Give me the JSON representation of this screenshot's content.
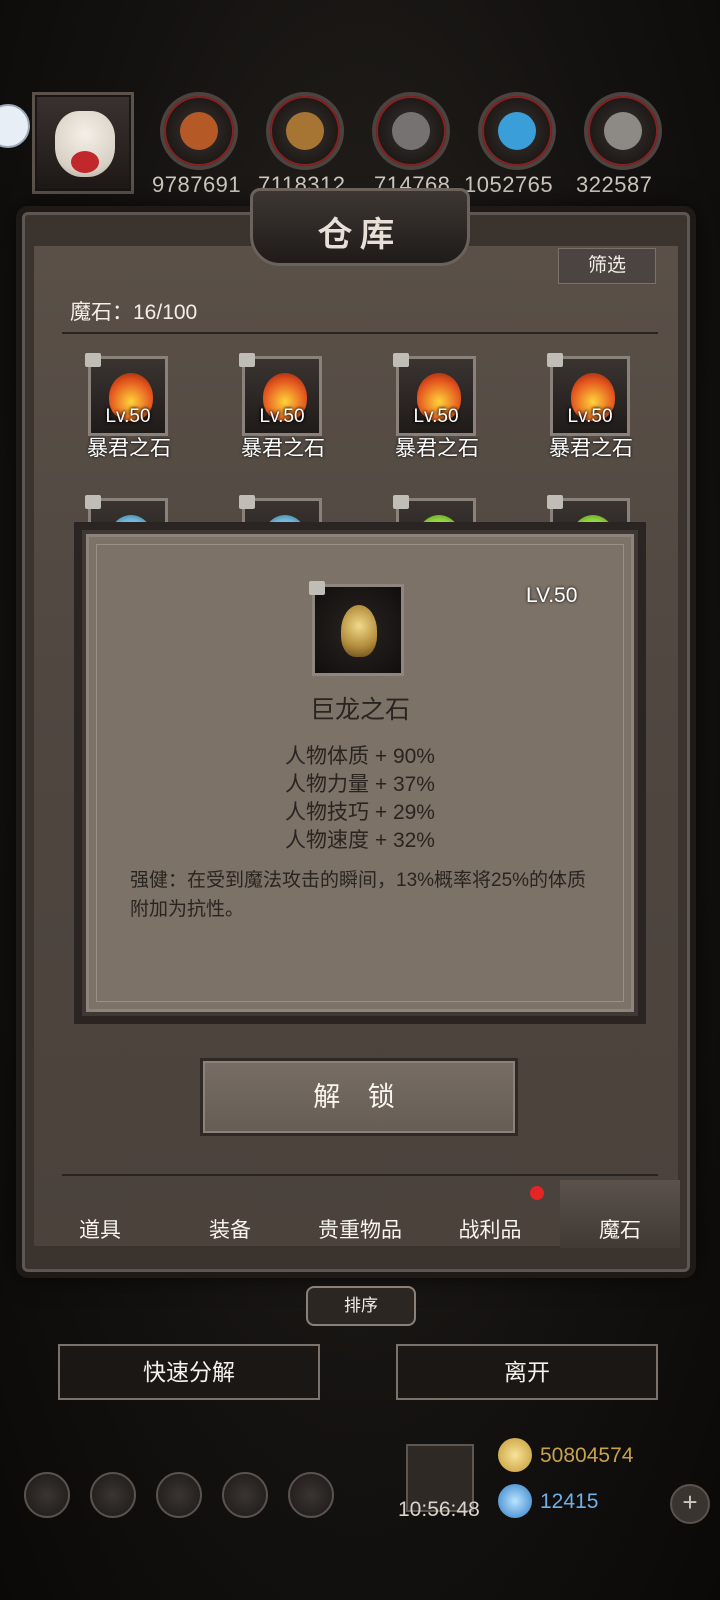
{
  "resources": [
    {
      "icon": "meat-icon",
      "value": "9787691",
      "color": "#b55a26"
    },
    {
      "icon": "wood-icon",
      "value": "7118312",
      "color": "#a77533"
    },
    {
      "icon": "iron-icon",
      "value": "714768",
      "color": "#777272"
    },
    {
      "icon": "crystal-icon",
      "value": "1052765",
      "color": "#3a9ed8"
    },
    {
      "icon": "silver-icon",
      "value": "322587",
      "color": "#8d8a86"
    }
  ],
  "warehouse": {
    "title": "仓库",
    "filter_label": "筛选",
    "count_label": "魔石：16/100",
    "items": [
      {
        "lv": "Lv.50",
        "name": "暴君之石",
        "color": "#e3541e"
      },
      {
        "lv": "Lv.50",
        "name": "暴君之石",
        "color": "#e3541e"
      },
      {
        "lv": "Lv.50",
        "name": "暴君之石",
        "color": "#e3541e"
      },
      {
        "lv": "Lv.50",
        "name": "暴君之石",
        "color": "#e3541e"
      },
      {
        "lv": "",
        "name": "",
        "color": "#6fb6d8"
      },
      {
        "lv": "",
        "name": "",
        "color": "#6fb6d8"
      },
      {
        "lv": "",
        "name": "",
        "color": "#8fd23f"
      },
      {
        "lv": "",
        "name": "",
        "color": "#8fd23f"
      }
    ]
  },
  "popup": {
    "lv": "LV.50",
    "name": "巨龙之石",
    "stats": [
      "人物体质 + 90%",
      "人物力量 + 37%",
      "人物技巧 + 29%",
      "人物速度 + 32%"
    ],
    "description": "强健：在受到魔法攻击的瞬间，13%概率将25%的体质附加为抗性。"
  },
  "unlock_label": "解 锁",
  "tabs": [
    "道具",
    "装备",
    "贵重物品",
    "战利品",
    "魔石"
  ],
  "sort_label": "排序",
  "quick_decompose_label": "快速分解",
  "leave_label": "离开",
  "clock": "10:56:48",
  "gold": "50804574",
  "gems": "12415"
}
